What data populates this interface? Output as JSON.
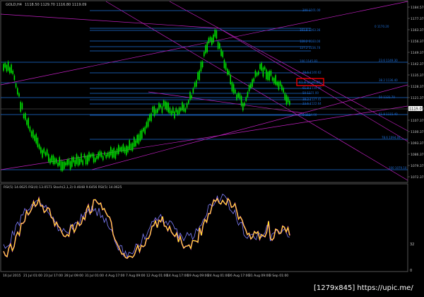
{
  "window": {
    "title": "GOLD,H4",
    "ohlc": "1118.50  1129.70  1116.80  1119.09"
  },
  "indicator": {
    "header": "RSI(5) 14.0625   RSI(4) 13.0571   Stoch(2,1,3) 0.4048  9.6456   RSI(5) 14.0625",
    "levels": [
      "32",
      "0"
    ]
  },
  "price_axis": {
    "labels": [
      "1184.57",
      "1177.37",
      "1163.37",
      "1156.37",
      "1149.37",
      "1142.37",
      "1135.37",
      "1128.37",
      "1121.37",
      "1114.37",
      "1107.37",
      "1100.37",
      "1093.37",
      "1086.37",
      "1079.37",
      "1072.37"
    ],
    "current_price": "1119.09"
  },
  "time_axis": {
    "labels": [
      "16 Jul 2015",
      "21 Jul 01:00",
      "23 Jul 17:00",
      "28 Jul 09:00",
      "31 Jul 01:00",
      "4 Aug 17:00",
      "7 Aug 09:00",
      "12 Aug 01:00",
      "14 Aug 17:00",
      "19 Aug 09:00",
      "24 Aug 01:00",
      "26 Aug 17:00",
      "31 Aug 09:00",
      "3 Sep 01:00"
    ]
  },
  "fib_levels": [
    "200  1101.00",
    "0  1170.20",
    "161.8  1163.36",
    "128.2  1160.00",
    "127.2  1156.70",
    "23.6  1149.30",
    "100  1145.83",
    "78.6  1140.62",
    "38.2  1136.40",
    "61.8  1134.49",
    "50  1131.00",
    "38.2  1127.41",
    "50  1131.70",
    "23.6  1122.64",
    "61.8  1115.40",
    "0  1114.00",
    "78.6  1094.04",
    "100  1079.10"
  ],
  "highlight_box_label": "61.8  1130.29",
  "watermark": "[1279x845] https://upic.me/",
  "colors": {
    "candle": "#00e000",
    "fib": "#1e6fd9",
    "channel": "#c020c0",
    "rsi_main": "#ffff00",
    "rsi_pink": "#ff30ff",
    "stoch": "#8080ff",
    "highlight": "#ff0000",
    "text": "#c8c8c8"
  }
}
